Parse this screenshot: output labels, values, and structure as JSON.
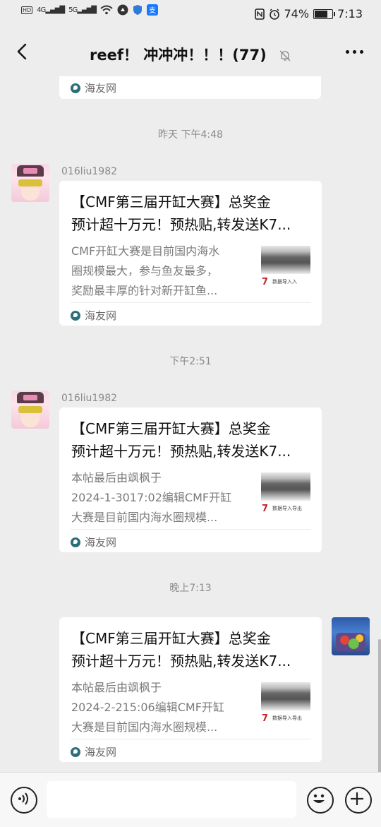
{
  "status_bar": {
    "left_indicators": [
      "HD",
      "4G",
      "5G"
    ],
    "battery_text": "74%",
    "battery_level": 0.74,
    "time": "7:13"
  },
  "header": {
    "title": "reef！ 冲冲冲！！！(77)"
  },
  "messages": [
    {
      "source": "海友网"
    },
    {
      "timestamp": "昨天 下午4:48",
      "sender": "016liu1982",
      "title_lines": [
        "【CMF第三届开缸大赛】总奖金",
        "预计超十万元！预热贴,转发送K7..."
      ],
      "desc_lines": [
        "CMF开缸大赛是目前国内海水",
        "圈规模最大，参与鱼友最多，",
        "奖励最丰厚的针对新开缸鱼..."
      ],
      "thumb_text": "数据导入入",
      "source": "海友网"
    },
    {
      "timestamp": "下午2:51",
      "sender": "016liu1982",
      "title_lines": [
        "【CMF第三届开缸大赛】总奖金",
        "预计超十万元！预热贴,转发送K7..."
      ],
      "desc_lines": [
        "本帖最后由飒枫于",
        "2024-1-3017:02编辑CMF开缸",
        "大赛是目前国内海水圈规模..."
      ],
      "thumb_text": "数据导入导出",
      "source": "海友网"
    },
    {
      "timestamp": "晚上7:13",
      "title_lines": [
        "【CMF第三届开缸大赛】总奖金",
        "预计超十万元！预热贴,转发送K7..."
      ],
      "desc_lines": [
        "本帖最后由飒枫于",
        "2024-2-215:06编辑CMF开缸",
        "大赛是目前国内海水圈规模..."
      ],
      "thumb_text": "数据导入导出",
      "source": "海友网"
    }
  ],
  "input_bar": {
    "voice_icon": "voice-icon",
    "emoji_icon": "emoji-icon",
    "plus_icon": "plus-icon"
  }
}
